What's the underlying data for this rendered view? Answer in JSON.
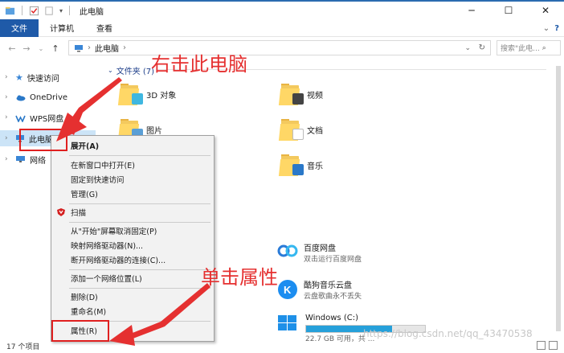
{
  "window": {
    "title": "此电脑",
    "controls": {
      "minimize": "─",
      "maximize": "☐",
      "close": "✕"
    }
  },
  "ribbon": {
    "tabs": [
      "文件",
      "计算机",
      "查看"
    ],
    "expand": "⌄",
    "help": "?"
  },
  "address": {
    "path": "此电脑",
    "search_placeholder": "搜索\"此电..."
  },
  "nav": {
    "items": [
      {
        "label": "快速访问",
        "icon": "star-icon",
        "color": "#3a86d6"
      },
      {
        "label": "OneDrive",
        "icon": "cloud-icon",
        "color": "#2a78c8"
      },
      {
        "label": "WPS网盘",
        "icon": "wps-cloud-icon",
        "color": "#2a78c8"
      },
      {
        "label": "此电脑",
        "icon": "computer-icon",
        "color": "#3a86d6"
      },
      {
        "label": "网络",
        "icon": "network-icon",
        "color": "#3a86d6"
      }
    ]
  },
  "content": {
    "group_header": "文件夹 (7)",
    "folders": [
      {
        "label": "3D 对象",
        "badge": "#3fb7e0"
      },
      {
        "label": "视频",
        "badge": "#444"
      },
      {
        "label": "图片",
        "badge": "#5a9fd6"
      },
      {
        "label": "文档",
        "badge": "#ffffff"
      },
      {
        "label": "音乐",
        "badge": "#2a78c8"
      }
    ],
    "apps": [
      {
        "name": "百度网盘",
        "desc": "双击运行百度网盘"
      },
      {
        "name": "酷狗音乐云盘",
        "desc": "云盘歌曲永不丢失"
      }
    ],
    "drive": {
      "name": "Windows (C:)",
      "free_text": "22.7 GB 可用，共 ...",
      "used_fraction": 0.72
    }
  },
  "context_menu": {
    "items": [
      {
        "label": "展开(A)",
        "bold": true
      },
      {
        "label": "在新窗口中打开(E)"
      },
      {
        "label": "固定到快速访问"
      },
      {
        "label": "管理(G)"
      },
      {
        "label": "扫描"
      },
      {
        "label": "从\"开始\"屏幕取消固定(P)"
      },
      {
        "label": "映射网络驱动器(N)..."
      },
      {
        "label": "断开网络驱动器的连接(C)..."
      },
      {
        "label": "添加一个网络位置(L)"
      },
      {
        "label": "删除(D)"
      },
      {
        "label": "重命名(M)"
      },
      {
        "label": "属性(R)"
      }
    ]
  },
  "annotations": {
    "right_click": "右击此电脑",
    "single_click": "单击属性",
    "accent_color": "#e53030"
  },
  "statusbar": {
    "count": "17 个项目"
  },
  "watermark": "https://blog.csdn.net/qq_43470538"
}
